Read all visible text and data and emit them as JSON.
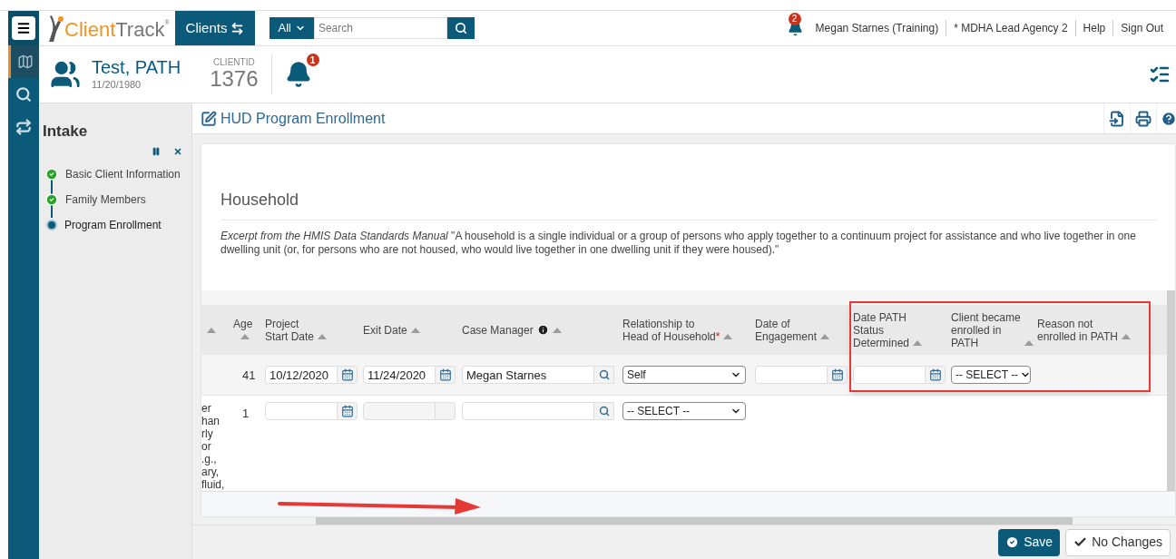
{
  "topbar": {
    "logo": {
      "first": "Client",
      "second": "Track",
      "mark": "®"
    },
    "module_tab": {
      "label": "Clients",
      "selected": true
    },
    "search": {
      "scope": "All",
      "placeholder": "Search"
    },
    "notifications": {
      "count": "2"
    },
    "links": [
      "Megan Starnes (Training)",
      "* MDHA Lead Agency 2",
      "Help",
      "Sign Out"
    ]
  },
  "rail": [
    {
      "kind": "map",
      "selected": true
    },
    {
      "kind": "search",
      "selected": false
    },
    {
      "kind": "workflow",
      "selected": false
    }
  ],
  "client": {
    "name": "Test, PATH",
    "dob": "11/20/1980",
    "id_label": "CLIENTID",
    "id": "1376",
    "alerts": "1"
  },
  "sidebar": {
    "title": "Intake",
    "steps": [
      {
        "label": "Basic Client Information",
        "completed": true,
        "selected": false
      },
      {
        "label": "Family Members",
        "completed": true,
        "selected": false
      },
      {
        "label": "Program Enrollment",
        "completed": false,
        "selected": true
      }
    ]
  },
  "page": {
    "title": "HUD Program Enrollment"
  },
  "section": {
    "title": "Household",
    "text": "*Excerpt from the HMIS Data Standards Manual* \"A household is a single individual or a group of persons who apply together to a continuum project for assistance and who live together in one dwelling unit (or, for persons who are not housed, who would live together in one dwelling unit if they were housed).\""
  },
  "table": {
    "columns": [
      {
        "sortable": true
      },
      {
        "label": [
          "Age"
        ],
        "sortable": true
      },
      {
        "label": [
          "Project",
          "Start Date"
        ],
        "sortable": true
      },
      {
        "label": [
          "Exit Date"
        ],
        "sortable": true
      },
      {
        "label": [
          "Case Manager"
        ],
        "sortable": true,
        "info": true
      },
      {
        "label": [
          "Relationship to",
          "Head of Household"
        ],
        "sortable": true,
        "required_mark": "*"
      },
      {
        "label": [
          "Date of",
          "Engagement"
        ],
        "sortable": true
      },
      {
        "label": [
          "Date PATH",
          "Status",
          "Determined"
        ],
        "sortable": true
      },
      {
        "label": [
          "Client became",
          "enrolled in",
          "PATH"
        ],
        "sortable": true
      },
      {
        "label": [
          "Reason not",
          "enrolled in PATH"
        ],
        "sortable": true
      }
    ],
    "rows": [
      {
        "cells": [
          {
            "kind": "none"
          },
          {
            "kind": "text",
            "value": "41"
          },
          {
            "kind": "date",
            "value": "10/12/2020",
            "disabled": false
          },
          {
            "kind": "date",
            "value": "11/24/2020",
            "disabled": false
          },
          {
            "kind": "lookup",
            "value": "Megan Starnes"
          },
          {
            "kind": "select",
            "value": "Self"
          },
          {
            "kind": "date",
            "disabled": false
          },
          {
            "kind": "date",
            "disabled": false
          },
          {
            "kind": "select",
            "value": "-- SELECT --"
          },
          {
            "kind": "none"
          }
        ]
      },
      {
        "cells": [
          {
            "kind": "lines",
            "lines": [
              "er",
              "han",
              "rly",
              "or",
              ".g.,",
              "ary,",
              "fluid,"
            ]
          },
          {
            "kind": "text",
            "value": "1"
          },
          {
            "kind": "date",
            "disabled": false
          },
          {
            "kind": "date",
            "disabled": true
          },
          {
            "kind": "lookup"
          },
          {
            "kind": "select",
            "value": "-- SELECT --"
          },
          {
            "kind": "none"
          },
          {
            "kind": "none"
          },
          {
            "kind": "none"
          },
          {
            "kind": "none"
          }
        ]
      }
    ]
  },
  "annotations": {
    "highlight_frame": true,
    "arrow": true
  },
  "footer": {
    "buttons": [
      {
        "label": "Save",
        "kind": "primary"
      },
      {
        "label": "No Changes",
        "kind": "secondary"
      }
    ]
  }
}
